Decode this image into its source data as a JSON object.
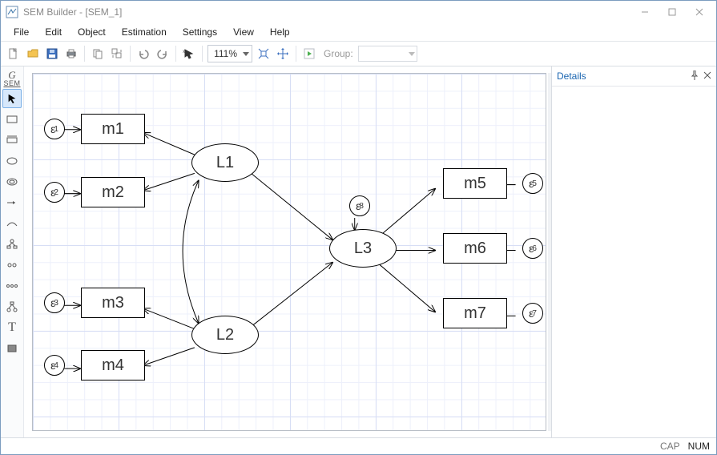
{
  "title": "SEM Builder - [SEM_1]",
  "menu": {
    "file": "File",
    "edit": "Edit",
    "object": "Object",
    "estimation": "Estimation",
    "settings": "Settings",
    "view": "View",
    "help": "Help"
  },
  "toolbar": {
    "zoom": "111%",
    "group_label": "Group:",
    "group_value": ""
  },
  "sidebar_mode": {
    "g": "G",
    "sem": "SEM"
  },
  "details_panel": {
    "title": "Details"
  },
  "statusbar": {
    "cap": "CAP",
    "num": "NUM"
  },
  "nodes": {
    "m1": "m1",
    "m2": "m2",
    "m3": "m3",
    "m4": "m4",
    "m5": "m5",
    "m6": "m6",
    "m7": "m7",
    "L1": "L1",
    "L2": "L2",
    "L3": "L3"
  },
  "errors": {
    "e1": "ε",
    "e1s": "1",
    "e2": "ε",
    "e2s": "2",
    "e3": "ε",
    "e3s": "3",
    "e4": "ε",
    "e4s": "4",
    "e5": "ε",
    "e5s": "5",
    "e6": "ε",
    "e6s": "6",
    "e7": "ε",
    "e7s": "7",
    "e8": "ε",
    "e8s": "8"
  },
  "icons": {
    "select": "select-tool-icon",
    "rect": "rect-tool-icon",
    "box": "box-tool-icon",
    "ellipse": "ellipse-tool-icon",
    "ring": "ring-tool-icon",
    "line": "line-tool-icon",
    "arc": "arc-tool-icon",
    "tree": "tree-tool-icon",
    "dots2": "dots2-tool-icon",
    "dots3": "dots3-tool-icon",
    "tree2": "tree2-tool-icon",
    "text": "text-tool-icon",
    "fill": "fill-tool-icon"
  }
}
